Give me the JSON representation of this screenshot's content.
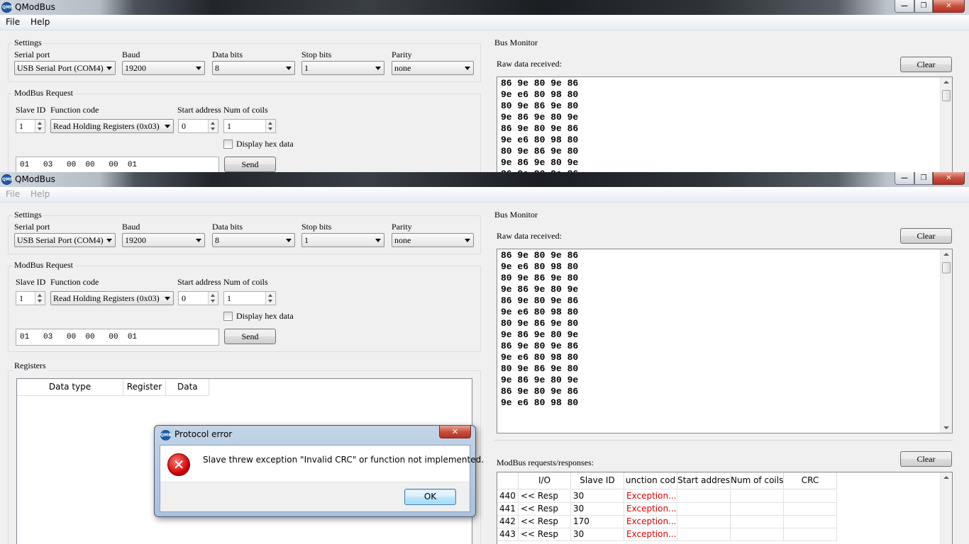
{
  "app": {
    "title": "QModBus",
    "icon_text": "QMB"
  },
  "menu": {
    "file": "File",
    "help": "Help"
  },
  "settings": {
    "title": "Settings",
    "serial_port_label": "Serial port",
    "serial_port_value": "USB Serial Port (COM4)",
    "baud_label": "Baud",
    "baud_value": "19200",
    "data_bits_label": "Data bits",
    "data_bits_value": "8",
    "stop_bits_label": "Stop bits",
    "stop_bits_value": "1",
    "parity_label": "Parity",
    "parity_value": "none"
  },
  "request": {
    "title": "ModBus Request",
    "slave_id_label": "Slave ID",
    "slave_id_value": "1",
    "function_code_label": "Function code",
    "function_code_value": "Read Holding Registers (0x03)",
    "start_address_label": "Start address",
    "start_address_value": "0",
    "num_coils_label": "Num of coils",
    "num_coils_value": "1",
    "display_hex_label": "Display hex data",
    "raw_request": "01   03   00  00   00  01",
    "send_label": "Send"
  },
  "registers": {
    "title": "Registers",
    "columns": [
      "Data type",
      "Register",
      "Data"
    ]
  },
  "bus_monitor": {
    "title": "Bus Monitor",
    "raw_label": "Raw data received:",
    "clear_label": "Clear",
    "raw_lines": [
      "86 9e 80 9e 86",
      "9e e6 80 98 80",
      "80 9e 86 9e 80",
      "9e 86 9e 80 9e",
      "86 9e 80 9e 86",
      "9e e6 80 98 80",
      "80 9e 86 9e 80",
      "9e 86 9e 80 9e",
      "86 9e 80 9e 86",
      "9e e6 80 98 80",
      "80 9e 86 9e 80",
      "9e 86 9e 80 9e",
      "86 9e 80 9e 86",
      "9e e6 80 98 80"
    ],
    "requests_label": "ModBus requests/responses:",
    "requests_clear_label": "Clear",
    "columns": [
      "I/O",
      "Slave ID",
      "unction cod",
      "Start addres",
      "Num of coils",
      "CRC"
    ],
    "rows": [
      {
        "num": "440",
        "io": "<< Resp",
        "slave": "30",
        "func": "Exception..."
      },
      {
        "num": "441",
        "io": "<< Resp",
        "slave": "30",
        "func": "Exception..."
      },
      {
        "num": "442",
        "io": "<< Resp",
        "slave": "170",
        "func": "Exception..."
      },
      {
        "num": "443",
        "io": "<< Resp",
        "slave": "30",
        "func": "Exception..."
      }
    ]
  },
  "dialog": {
    "title": "Protocol error",
    "message": "Slave threw exception \"Invalid CRC\" or function not implemented.",
    "ok_label": "OK"
  },
  "icons": {
    "app": "qmodbus-logo-icon",
    "error": "error-icon"
  },
  "colors": {
    "exception_text": "#e00000",
    "close_button": "#c7503e"
  }
}
